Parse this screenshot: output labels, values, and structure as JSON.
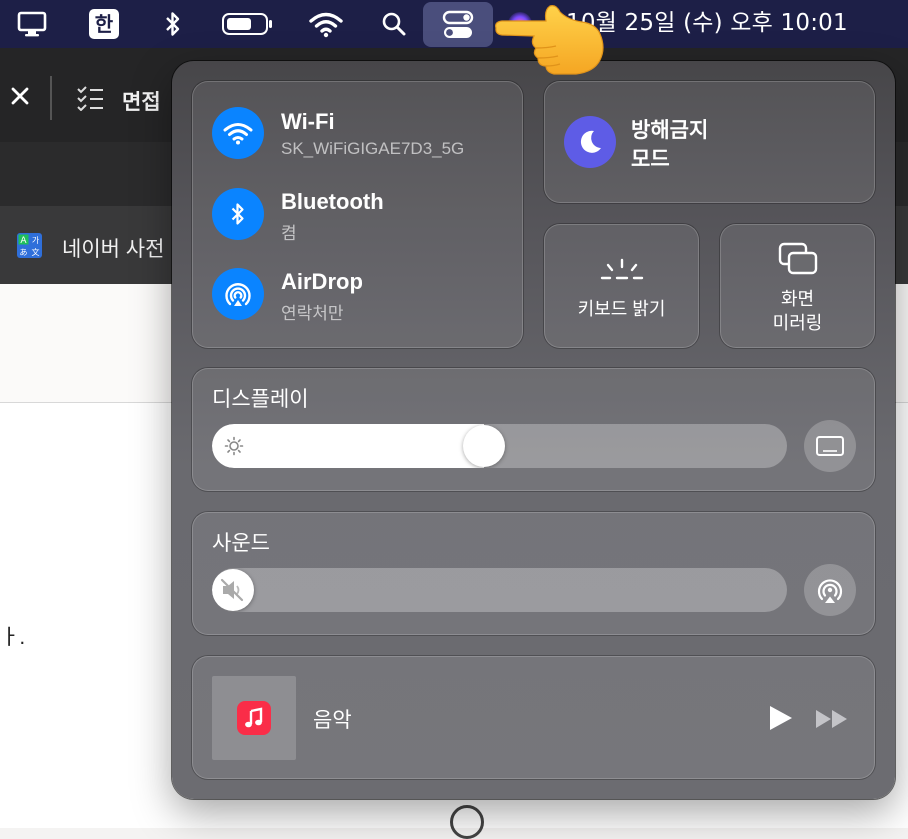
{
  "menubar": {
    "input_method": "한",
    "clock": "10월 25일 (수) 오후  10:01"
  },
  "background_app": {
    "toolbar_label": "면접",
    "bookmark_label": "네이버 사전",
    "page_text": "ㅏ."
  },
  "control_center": {
    "connectivity": {
      "wifi": {
        "title": "Wi-Fi",
        "subtitle": "SK_WiFiGIGAE7D3_5G"
      },
      "bluetooth": {
        "title": "Bluetooth",
        "subtitle": "켬"
      },
      "airdrop": {
        "title": "AirDrop",
        "subtitle": "연락처만"
      }
    },
    "focus": {
      "line1": "방해금지",
      "line2": "모드"
    },
    "keyboard_brightness": {
      "label": "키보드 밝기"
    },
    "screen_mirroring": {
      "line1": "화면",
      "line2": "미러링"
    },
    "display": {
      "title": "디스플레이",
      "brightness": 0.47
    },
    "sound": {
      "title": "사운드",
      "volume": 0.0
    },
    "now_playing": {
      "title": "음악"
    }
  },
  "colors": {
    "menubar_bg": "#1d1f47",
    "accent_blue": "#0a84ff",
    "focus_purple": "#5e5ce6",
    "music_red": "#fa2d48"
  },
  "icons": {
    "menubar": [
      "display-icon",
      "input-method-icon",
      "bluetooth-icon",
      "battery-icon",
      "wifi-icon",
      "search-icon",
      "control-center-icon",
      "siri-icon"
    ],
    "pointer": "pointing-hand-emoji"
  }
}
